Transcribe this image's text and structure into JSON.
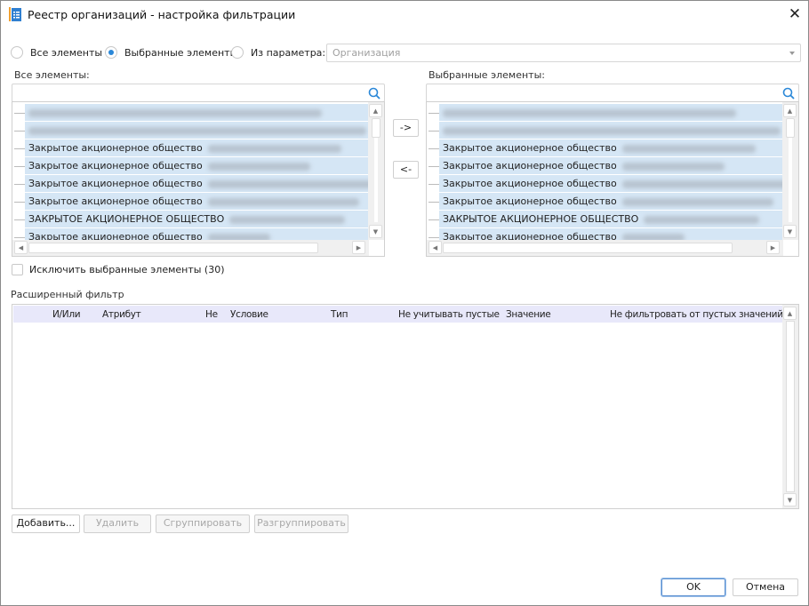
{
  "window": {
    "title": "Реестр организаций - настройка фильтрации",
    "close_icon": "close-icon",
    "app_icon": "table-document-icon"
  },
  "source": {
    "radio_all": "Все элементы",
    "radio_selected": "Выбранные элементы",
    "radio_param": "Из параметра:",
    "selected": "radio_selected",
    "param_combo": "Организация"
  },
  "all_list": {
    "label": "Все элементы:",
    "search_value": "",
    "rows": [
      {
        "text": "",
        "blurred": true
      },
      {
        "text": "",
        "blurred": true
      },
      {
        "text": "Закрытое акционерное общество",
        "blurred": true
      },
      {
        "text": "Закрытое акционерное общество",
        "blurred": true
      },
      {
        "text": "Закрытое акционерное общество",
        "blurred": true
      },
      {
        "text": "Закрытое акционерное общество",
        "blurred": true
      },
      {
        "text": "ЗАКРЫТОЕ АКЦИОНЕРНОЕ ОБЩЕСТВО",
        "blurred": true
      },
      {
        "text": "Закрытое акционерное общество",
        "blurred": true
      }
    ]
  },
  "selected_list": {
    "label": "Выбранные элементы:",
    "search_value": "",
    "rows": [
      {
        "text": "",
        "blurred": true
      },
      {
        "text": "",
        "blurred": true
      },
      {
        "text": "Закрытое акционерное общество",
        "blurred": true
      },
      {
        "text": "Закрытое акционерное общество",
        "blurred": true
      },
      {
        "text": "Закрытое акционерное общество",
        "blurred": true
      },
      {
        "text": "Закрытое акционерное общество",
        "blurred": true
      },
      {
        "text": "ЗАКРЫТОЕ АКЦИОНЕРНОЕ ОБЩЕСТВО",
        "blurred": true
      },
      {
        "text": "Закрытое акционерное общество",
        "blurred": true
      }
    ]
  },
  "move": {
    "add": "->",
    "remove": "<-"
  },
  "exclude": {
    "label": "Исключить выбранные элементы (30)",
    "checked": false
  },
  "advanced": {
    "label": "Расширенный фильтр",
    "columns": [
      "И/Или",
      "Атрибут",
      "Не",
      "Условие",
      "Тип",
      "Не учитывать пустые",
      "Значение",
      "Не фильтровать от пустых значений"
    ],
    "rows": []
  },
  "actions": {
    "add": "Добавить...",
    "delete": "Удалить",
    "group": "Сгруппировать",
    "ungroup": "Разгруппировать"
  },
  "footer": {
    "ok": "OK",
    "cancel": "Отмена"
  },
  "colors": {
    "selection": "#d5e6f5",
    "accent": "#2b88d8",
    "header": "#e8e8fa"
  }
}
